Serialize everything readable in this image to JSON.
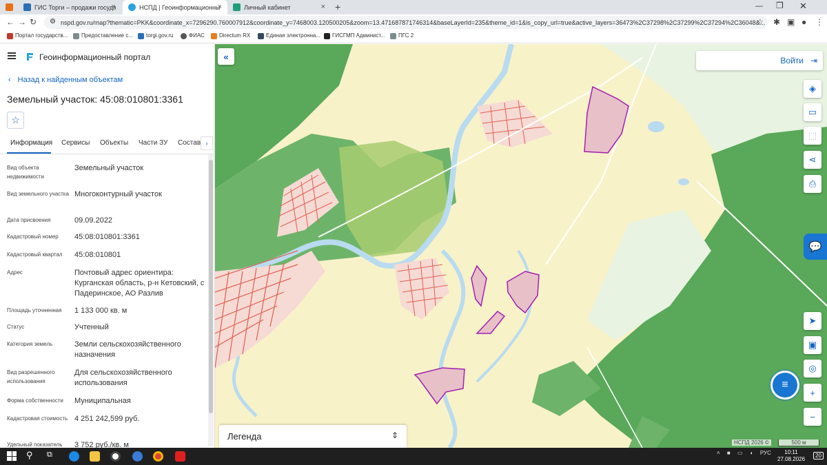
{
  "browser": {
    "tabs": [
      {
        "title": "ГИС Торги – продажи государс"
      },
      {
        "title": "НСПД | Геоинформационный п"
      },
      {
        "title": "Личный кабинет"
      }
    ],
    "url": "nspd.gov.ru/map?thematic=PKK&coordinate_x=7296290.760007912&coordinate_y=7468003.120500205&zoom=13.471687871746314&baseLayerId=235&theme_id=1&is_copy_url=true&active_layers=36473%2C37298%2C37299%2C37294%2C36048&...",
    "bookmarks": [
      "Портал государств...",
      "Предоставление с...",
      "torgi.gov.ru",
      "ФИАС",
      "Directum RX",
      "Единая электронна...",
      "ГИСГМП Админист...",
      "ПГС 2"
    ]
  },
  "colors": {
    "accent": "#1565c0",
    "forest": "#5aa85a",
    "field": "#f8f2c9",
    "water": "#b9dbf0",
    "parcel_border": "#a020b0",
    "parcel_fill": "#e8c0c8",
    "settlement": "#e06050"
  },
  "icons": [
    "menu-icon",
    "portal-logo-icon",
    "star-icon",
    "chevron-left-icon",
    "chevron-right-icon",
    "collapse-icon",
    "login-icon",
    "layers-icon",
    "ruler-icon",
    "select-area-icon",
    "share-icon",
    "print-icon",
    "chat-icon",
    "navigate-icon",
    "basemap-icon",
    "locate-icon",
    "zoom-in-icon",
    "zoom-out-icon",
    "help-icon",
    "chevron-updown-icon"
  ],
  "panel": {
    "app_title": "Геоинформационный портал",
    "back_label": "Назад к найденным объектам",
    "object_title": "Земельный участок: 45:08:010801:3361",
    "tabs": [
      "Информация",
      "Сервисы",
      "Объекты",
      "Части ЗУ",
      "Состав"
    ],
    "fields": [
      {
        "label": "Вид объекта недвижимости",
        "value": "Земельный участок"
      },
      {
        "label": "Вид земельного участка",
        "value": "Многоконтурный участок"
      },
      {
        "label": "Дата присвоения",
        "value": "09.09.2022"
      },
      {
        "label": "Кадастровый номер",
        "value": "45:08:010801:3361"
      },
      {
        "label": "Кадастровый квартал",
        "value": "45:08:010801"
      },
      {
        "label": "Адрес",
        "value": "Почтовый адрес ориентира: Курганская область, р-н Кетовский, с Падеринское, АО Разлив"
      },
      {
        "label": "Площадь уточненная",
        "value": "1 133 000 кв. м"
      },
      {
        "label": "Статус",
        "value": "Учтенный"
      },
      {
        "label": "Категория земель",
        "value": "Земли сельскохозяйственного назначения"
      },
      {
        "label": "Вид разрешенного использования",
        "value": "Для сельскохозяйственного использования"
      },
      {
        "label": "Форма собственности",
        "value": "Муниципальная"
      },
      {
        "label": "Кадастровая стоимость",
        "value": "4 251 242,599 руб."
      },
      {
        "label": "Удельный показатель",
        "value": "3 752 руб./кв. м"
      }
    ]
  },
  "map": {
    "login_label": "Войти",
    "legend_label": "Легенда",
    "copyright": "НСПД 2026 ©",
    "scale_label": "500 м"
  },
  "taskbar": {
    "language": "РУС",
    "time": "10:11",
    "date": "27.08.2026",
    "notifications": "20"
  }
}
